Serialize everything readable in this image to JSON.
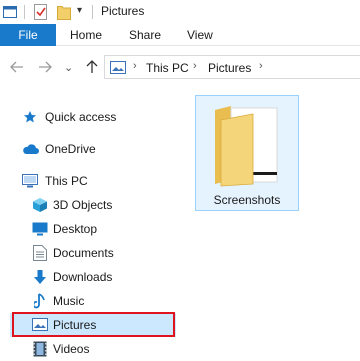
{
  "window": {
    "title": "Pictures"
  },
  "quick_access_toolbar": {
    "icons": [
      "explorer-window-icon",
      "properties-check-icon",
      "new-folder-icon",
      "customize-dropdown-icon"
    ]
  },
  "ribbon": {
    "tabs": [
      {
        "label": "File",
        "active": true
      },
      {
        "label": "Home"
      },
      {
        "label": "Share"
      },
      {
        "label": "View"
      }
    ]
  },
  "navigation": {
    "back_icon": "arrow-left-icon",
    "forward_icon": "arrow-right-icon",
    "recent_icon": "chevron-down-icon",
    "up_icon": "arrow-up-icon"
  },
  "address_bar": {
    "breadcrumb": [
      "This PC",
      "Pictures"
    ],
    "separator": "›"
  },
  "sidebar": {
    "items": [
      {
        "label": "Quick access",
        "icon": "star-icon"
      },
      {
        "label": "OneDrive",
        "icon": "cloud-icon"
      },
      {
        "label": "This PC",
        "icon": "computer-icon"
      },
      {
        "label": "3D Objects",
        "icon": "cube-icon"
      },
      {
        "label": "Desktop",
        "icon": "desktop-icon"
      },
      {
        "label": "Documents",
        "icon": "document-icon"
      },
      {
        "label": "Downloads",
        "icon": "download-icon"
      },
      {
        "label": "Music",
        "icon": "music-icon"
      },
      {
        "label": "Pictures",
        "icon": "pictures-icon",
        "selected": true
      },
      {
        "label": "Videos",
        "icon": "film-icon"
      }
    ]
  },
  "content": {
    "items": [
      {
        "name": "Screenshots",
        "type": "folder",
        "selected": true
      }
    ]
  },
  "colors": {
    "file_tab": "#1979ca",
    "selection": "#cce8ff",
    "tile_selection": "#e5f3ff",
    "highlight_border": "#e0141e",
    "folder_yellow": "#f3cf6a"
  }
}
